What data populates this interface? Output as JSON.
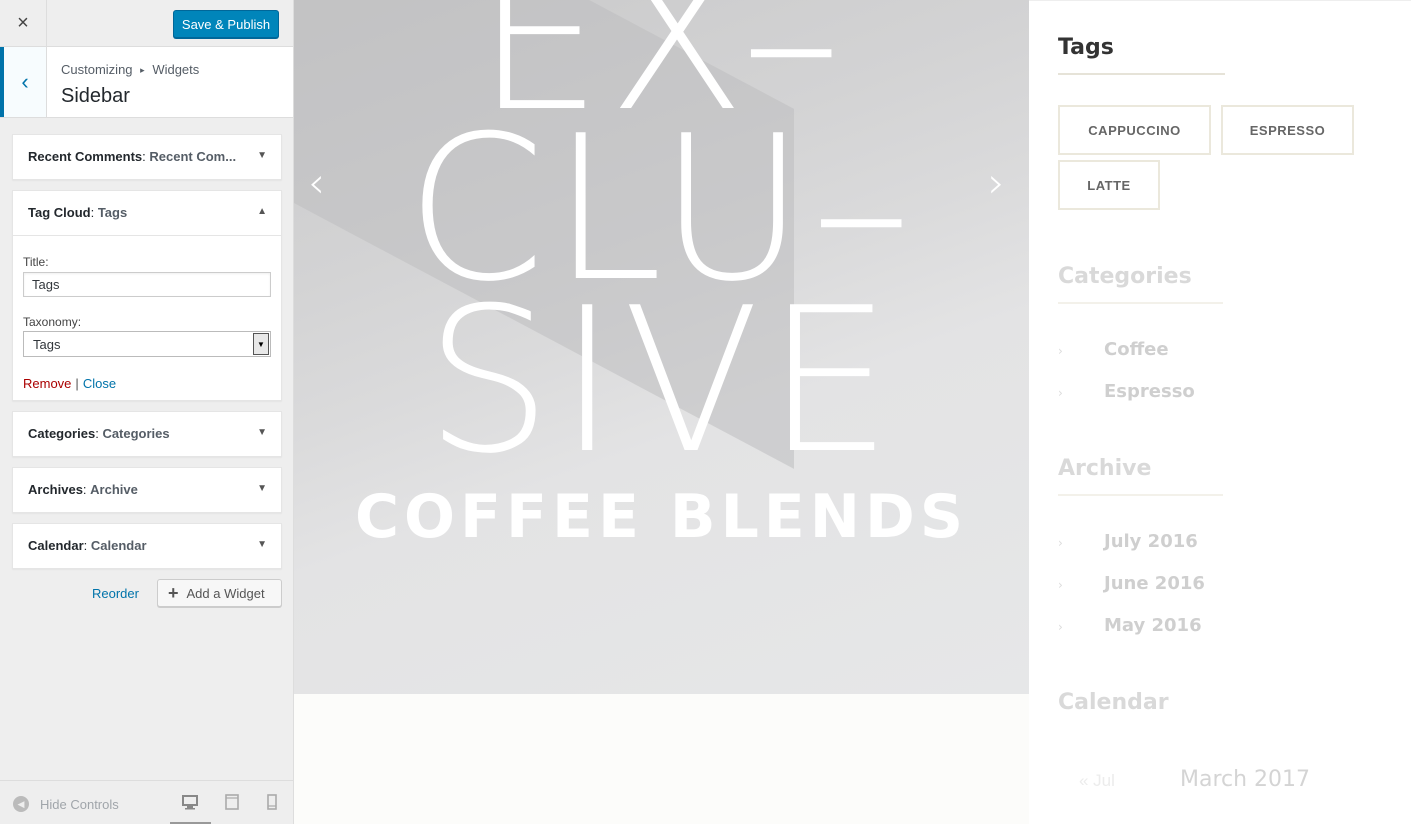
{
  "customizer": {
    "close_icon": "×",
    "save_label": "Save & Publish",
    "breadcrumb": {
      "root": "Customizing",
      "separator": "▸",
      "current": "Widgets"
    },
    "section_title": "Sidebar",
    "widgets": [
      {
        "type": "Recent Comments",
        "title": "Recent Com...",
        "expanded": false
      },
      {
        "type": "Tag Cloud",
        "title": "Tags",
        "expanded": true
      },
      {
        "type": "Categories",
        "title": "Categories",
        "expanded": false
      },
      {
        "type": "Archives",
        "title": "Archive",
        "expanded": false
      },
      {
        "type": "Calendar",
        "title": "Calendar",
        "expanded": false
      }
    ],
    "tag_cloud_form": {
      "title_label": "Title:",
      "title_value": "Tags",
      "taxonomy_label": "Taxonomy:",
      "taxonomy_value": "Tags",
      "remove_label": "Remove",
      "separator": "|",
      "close_label": "Close"
    },
    "reorder_label": "Reorder",
    "add_widget_label": "Add a Widget",
    "hide_controls_label": "Hide Controls",
    "devices": [
      "desktop-icon",
      "tablet-icon",
      "mobile-icon"
    ],
    "accent_color": "#0073aa"
  },
  "preview": {
    "hero": {
      "lines": [
        "EX–",
        "CLU–",
        "SIVE"
      ],
      "subtitle": "COFFEE BLENDS",
      "prev_arrow": "‹",
      "next_arrow": "›"
    },
    "sidebar": {
      "tags_title": "Tags",
      "tags": [
        "CAPPUCCINO",
        "ESPRESSO",
        "LATTE"
      ],
      "categories_title": "Categories",
      "categories": [
        "Coffee",
        "Espresso"
      ],
      "archive_title": "Archive",
      "archives": [
        "July 2016",
        "June 2016",
        "May 2016"
      ],
      "calendar_title": "Calendar",
      "calendar_prev": "« Jul",
      "calendar_month": "March 2017"
    }
  }
}
